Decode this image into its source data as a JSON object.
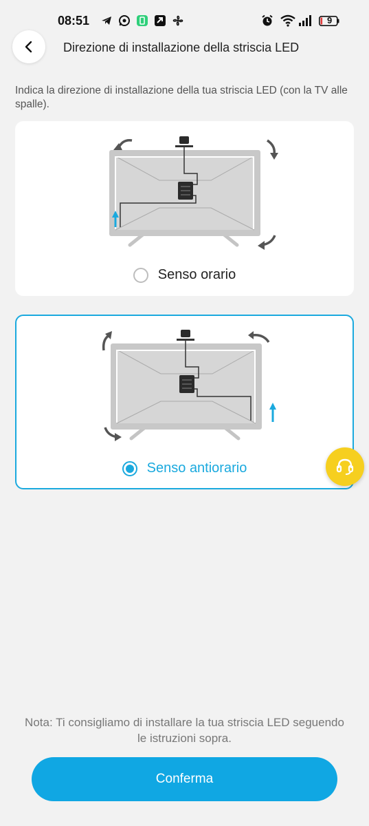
{
  "status_bar": {
    "time": "08:51",
    "icons": [
      "telegram-icon",
      "whatsapp-icon",
      "sim-app-icon",
      "app-icon",
      "fan-icon",
      "alarm-icon",
      "wifi-icon",
      "signal-icon"
    ],
    "battery": "9"
  },
  "header": {
    "title": "Direzione di installazione della striscia LED",
    "back_icon": "chevron-left-icon"
  },
  "instruction": "Indica la direzione di installazione della tua striscia LED (con la TV alle spalle).",
  "options": [
    {
      "label": "Senso orario",
      "selected": false
    },
    {
      "label": "Senso antiorario",
      "selected": true
    }
  ],
  "note": "Nota: Ti consigliamo di installare la tua striscia LED seguendo le istruzioni sopra.",
  "confirm_label": "Conferma",
  "colors": {
    "accent": "#1aa9de",
    "button": "#10a7e3",
    "support": "#f6cf1f",
    "background": "#f2f2f2"
  }
}
